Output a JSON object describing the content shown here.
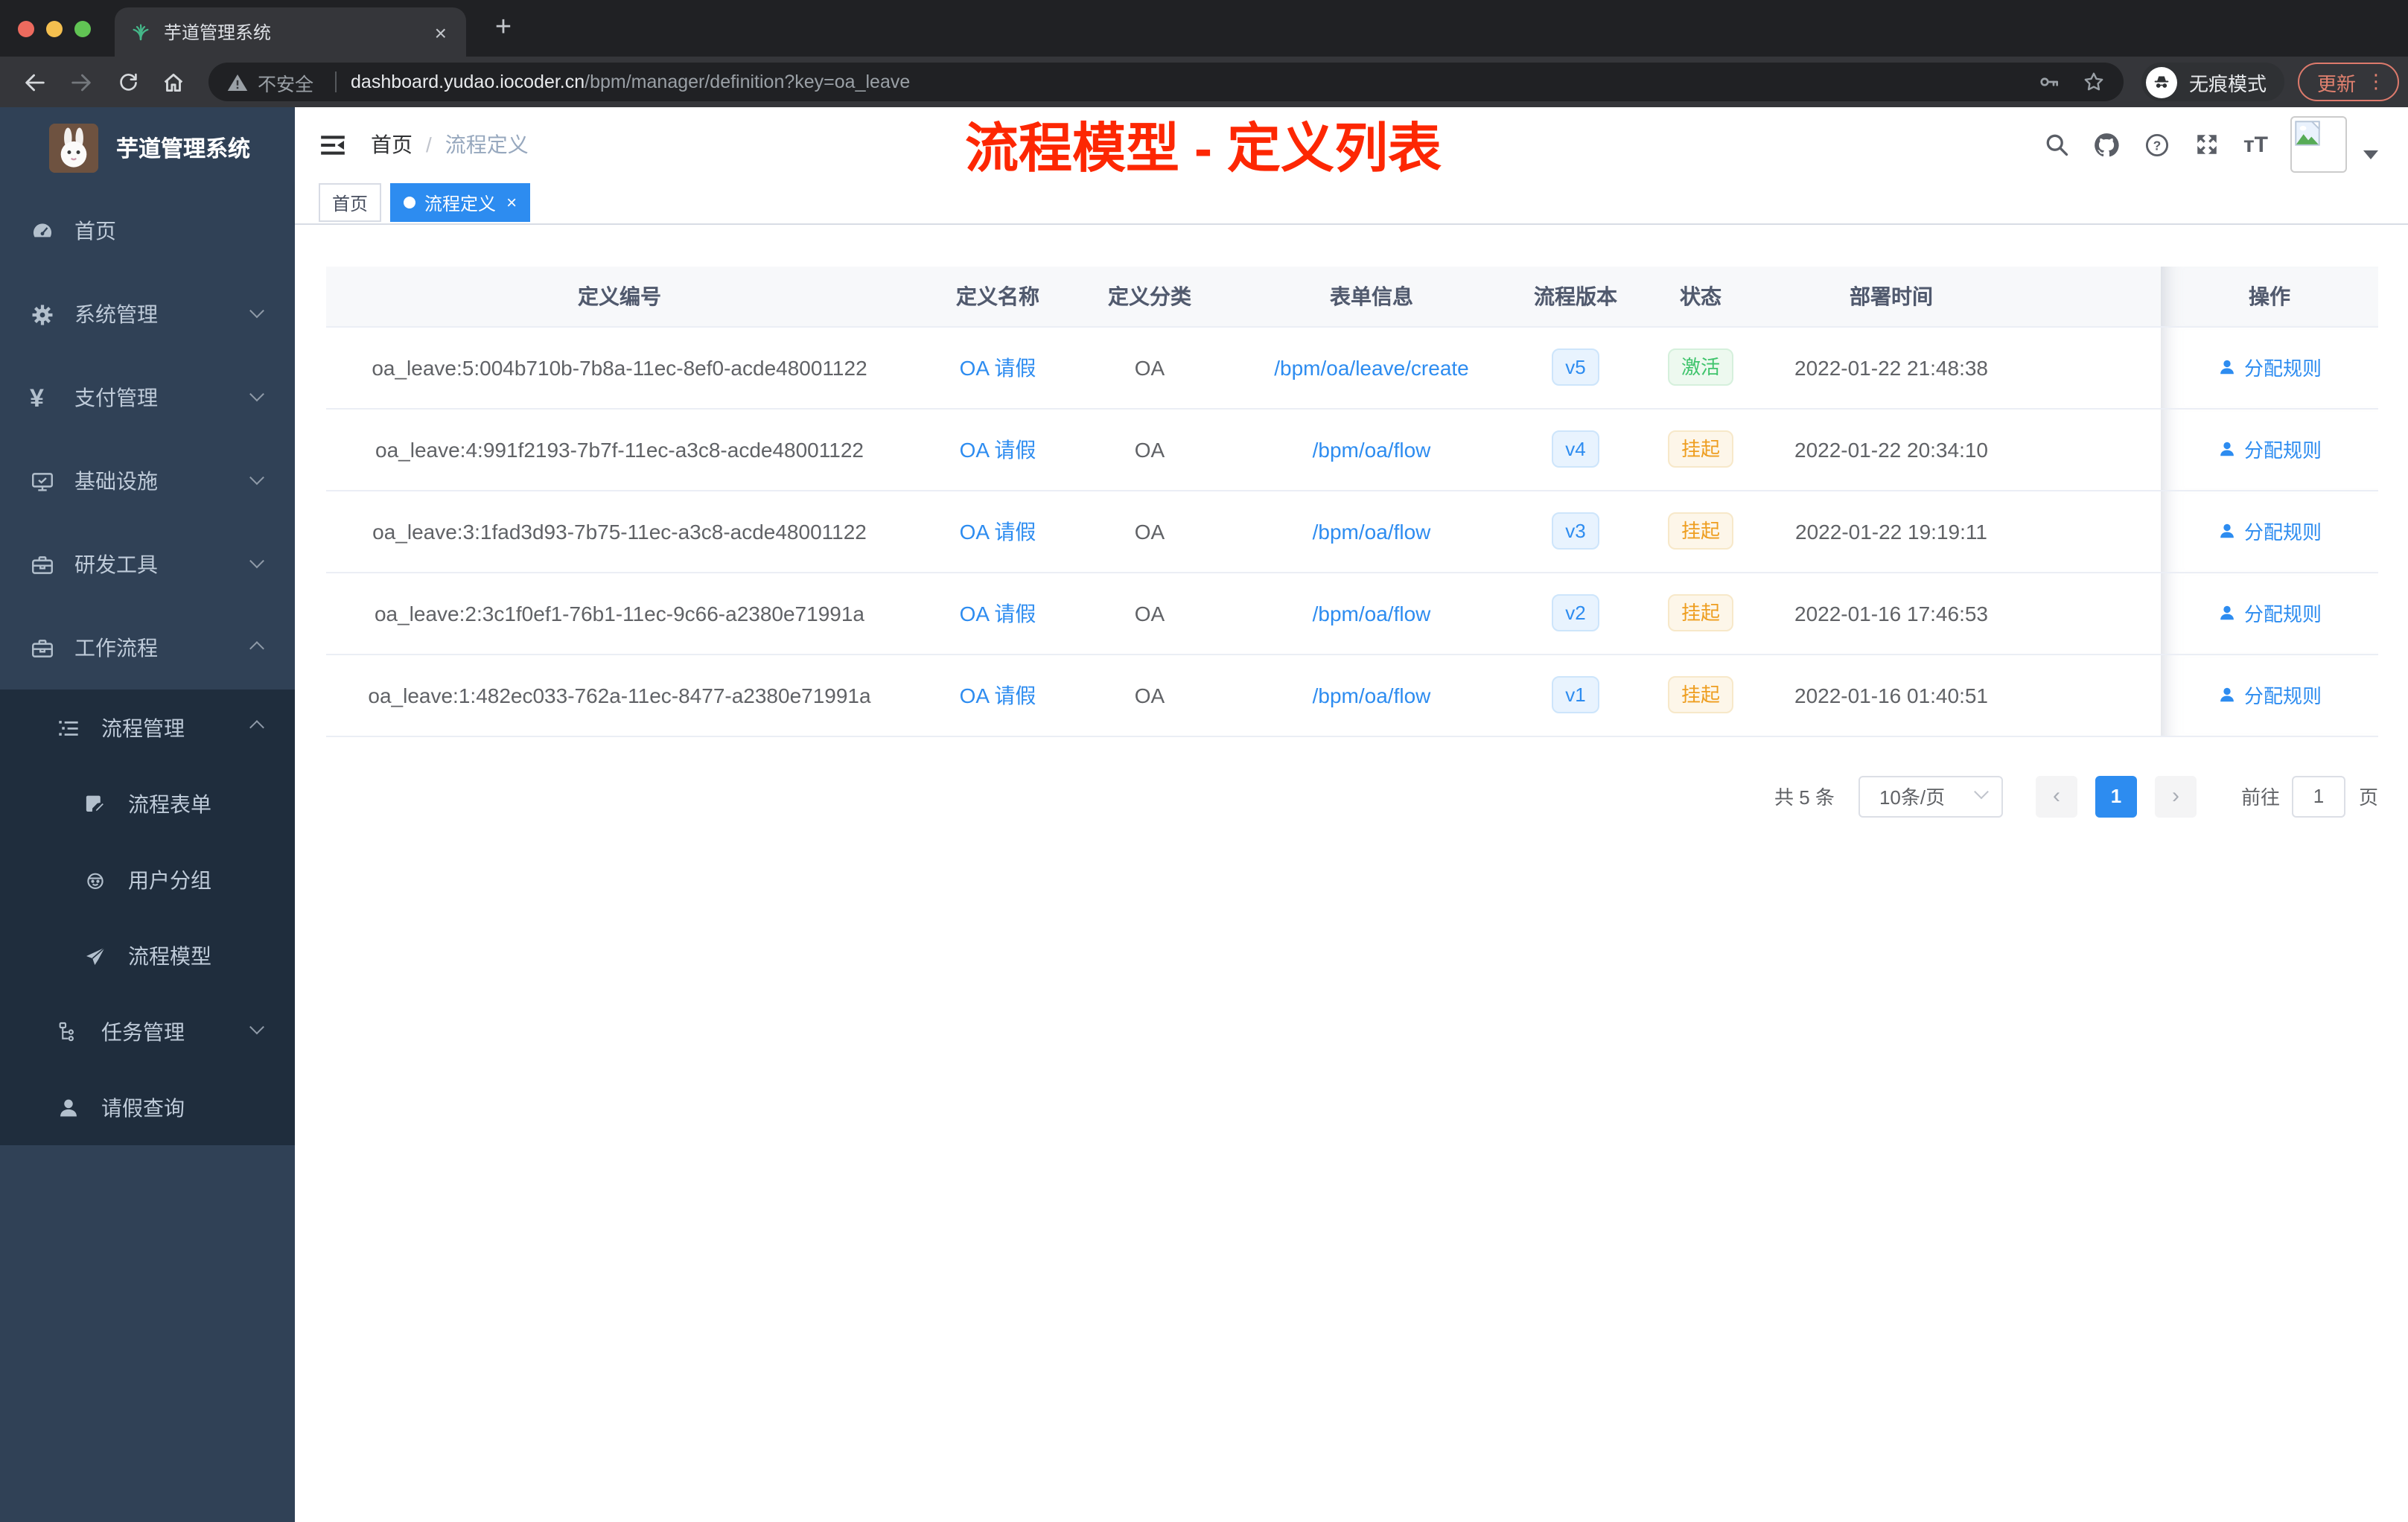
{
  "browser": {
    "tab": {
      "title": "芋道管理系统",
      "close": "×",
      "new_tab": "+"
    },
    "toolbar": {
      "security_warning": "不安全",
      "url_domain": "dashboard.yudao.iocoder.cn",
      "url_path": "/bpm/manager/definition?key=oa_leave",
      "incognito_label": "无痕模式",
      "update_label": "更新",
      "menu_dots": "⋮"
    }
  },
  "sidebar": {
    "logo_title": "芋道管理系统",
    "menu": [
      {
        "label": "首页",
        "icon": "dashboard-icon",
        "level": 1,
        "arrow": "",
        "dark": false
      },
      {
        "label": "系统管理",
        "icon": "gear-icon",
        "level": 1,
        "arrow": "down",
        "dark": false
      },
      {
        "label": "支付管理",
        "icon": "yen-icon",
        "level": 1,
        "arrow": "down",
        "dark": false
      },
      {
        "label": "基础设施",
        "icon": "monitor-icon",
        "level": 1,
        "arrow": "down",
        "dark": false
      },
      {
        "label": "研发工具",
        "icon": "toolbox-icon",
        "level": 1,
        "arrow": "down",
        "dark": false
      },
      {
        "label": "工作流程",
        "icon": "briefcase-icon",
        "level": 1,
        "arrow": "up",
        "dark": false
      },
      {
        "label": "流程管理",
        "icon": "tree-list-icon",
        "level": 2,
        "arrow": "up",
        "dark": true
      },
      {
        "label": "流程表单",
        "icon": "form-icon",
        "level": 3,
        "arrow": "",
        "dark": true
      },
      {
        "label": "用户分组",
        "icon": "robot-icon",
        "level": 3,
        "arrow": "",
        "dark": true
      },
      {
        "label": "流程模型",
        "icon": "paper-plane-icon",
        "level": 3,
        "arrow": "",
        "dark": true
      },
      {
        "label": "任务管理",
        "icon": "tree-icon",
        "level": 2,
        "arrow": "down",
        "dark": true
      },
      {
        "label": "请假查询",
        "icon": "user-icon",
        "level": 2,
        "arrow": "",
        "dark": true
      }
    ]
  },
  "navbar": {
    "breadcrumb_home": "首页",
    "breadcrumb_separator": "/",
    "breadcrumb_current": "流程定义"
  },
  "annotation": {
    "text": "流程模型 - 定义列表",
    "color": "#fd2703"
  },
  "tags": [
    {
      "label": "首页",
      "active": false
    },
    {
      "label": "流程定义",
      "active": true,
      "close": "×"
    }
  ],
  "table": {
    "headers": [
      "定义编号",
      "定义名称",
      "定义分类",
      "表单信息",
      "流程版本",
      "状态",
      "部署时间",
      "操作"
    ],
    "rows": [
      {
        "id": "oa_leave:5:004b710b-7b8a-11ec-8ef0-acde48001122",
        "name": "OA 请假",
        "category": "OA",
        "form": "/bpm/oa/leave/create",
        "version": "v5",
        "status": "激活",
        "status_type": "success",
        "deployed": "2022-01-22 21:48:38",
        "action": "分配规则"
      },
      {
        "id": "oa_leave:4:991f2193-7b7f-11ec-a3c8-acde48001122",
        "name": "OA 请假",
        "category": "OA",
        "form": "/bpm/oa/flow",
        "version": "v4",
        "status": "挂起",
        "status_type": "warning",
        "deployed": "2022-01-22 20:34:10",
        "action": "分配规则"
      },
      {
        "id": "oa_leave:3:1fad3d93-7b75-11ec-a3c8-acde48001122",
        "name": "OA 请假",
        "category": "OA",
        "form": "/bpm/oa/flow",
        "version": "v3",
        "status": "挂起",
        "status_type": "warning",
        "deployed": "2022-01-22 19:19:11",
        "action": "分配规则"
      },
      {
        "id": "oa_leave:2:3c1f0ef1-76b1-11ec-9c66-a2380e71991a",
        "name": "OA 请假",
        "category": "OA",
        "form": "/bpm/oa/flow",
        "version": "v2",
        "status": "挂起",
        "status_type": "warning",
        "deployed": "2022-01-16 17:46:53",
        "action": "分配规则"
      },
      {
        "id": "oa_leave:1:482ec033-762a-11ec-8477-a2380e71991a",
        "name": "OA 请假",
        "category": "OA",
        "form": "/bpm/oa/flow",
        "version": "v1",
        "status": "挂起",
        "status_type": "warning",
        "deployed": "2022-01-16 01:40:51",
        "action": "分配规则"
      }
    ]
  },
  "pagination": {
    "total": "共 5 条",
    "page_size": "10条/页",
    "prev": "‹",
    "current": "1",
    "next": "›",
    "goto_label": "前往",
    "goto_value": "1",
    "page_unit": "页"
  },
  "colors": {
    "accent": "#2d8cf0",
    "annotation_red": "#fd2703",
    "success_green": "#3fc46c",
    "warning_orange": "#ee9e20",
    "sidebar_bg": "#304156",
    "sidebar_submenu_bg": "#1f2d3d"
  }
}
